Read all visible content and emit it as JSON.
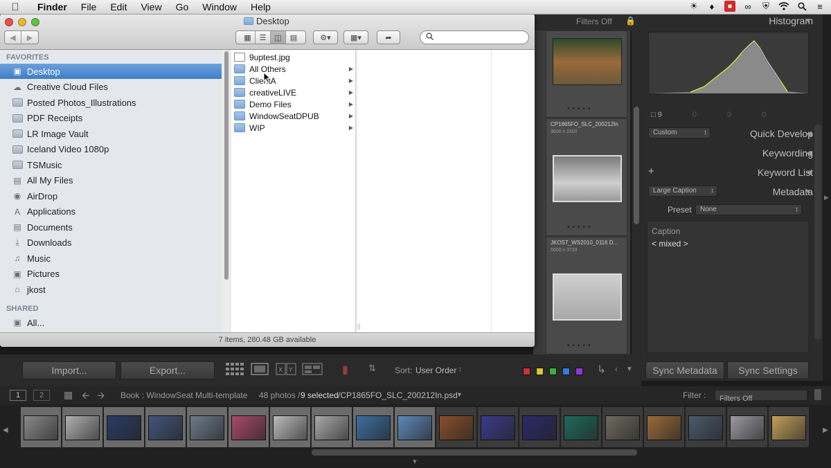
{
  "menubar": {
    "app": "Finder",
    "items": [
      "File",
      "Edit",
      "View",
      "Go",
      "Window",
      "Help"
    ]
  },
  "finder": {
    "title": "Desktop",
    "search_placeholder": "",
    "sidebar": {
      "favorites_header": "FAVORITES",
      "favorites": [
        {
          "label": "Desktop",
          "icon": "desktop-icon"
        },
        {
          "label": "Creative Cloud Files",
          "icon": "cloud-icon"
        },
        {
          "label": "Posted Photos_Illustrations",
          "icon": "folder-icon"
        },
        {
          "label": "PDF Receipts",
          "icon": "folder-icon"
        },
        {
          "label": "LR Image Vault",
          "icon": "folder-icon"
        },
        {
          "label": "Iceland Video 1080p",
          "icon": "folder-icon"
        },
        {
          "label": "TSMusic",
          "icon": "folder-icon"
        },
        {
          "label": "All My Files",
          "icon": "files-icon"
        },
        {
          "label": "AirDrop",
          "icon": "airdrop-icon"
        },
        {
          "label": "Applications",
          "icon": "applications-icon"
        },
        {
          "label": "Documents",
          "icon": "documents-icon"
        },
        {
          "label": "Downloads",
          "icon": "downloads-icon"
        },
        {
          "label": "Music",
          "icon": "music-icon"
        },
        {
          "label": "Pictures",
          "icon": "pictures-icon"
        },
        {
          "label": "jkost",
          "icon": "home-icon"
        }
      ],
      "shared_header": "SHARED",
      "shared": [
        {
          "label": "All...",
          "icon": "network-icon"
        }
      ]
    },
    "column1": [
      {
        "label": "9uptest.jpg",
        "type": "file"
      },
      {
        "label": "All Others",
        "type": "folder"
      },
      {
        "label": "ClientA",
        "type": "folder"
      },
      {
        "label": "creativeLIVE",
        "type": "folder"
      },
      {
        "label": "Demo Files",
        "type": "folder"
      },
      {
        "label": "WindowSeatDPUB",
        "type": "folder"
      },
      {
        "label": "WIP",
        "type": "folder"
      }
    ],
    "status": "7 items, 280.48 GB available"
  },
  "lightroom": {
    "filters_off_top": "Filters Off",
    "grid_cells": [
      {
        "caption": "CP1865FO_SLC_200212In",
        "dims": "3600 x 2400"
      },
      {
        "caption": "JKOST_WS2010_0116    D...",
        "dims": "5600 x 3733"
      }
    ],
    "right_panel": {
      "histogram": "Histogram",
      "histo_count": "9",
      "histo_zeros": [
        "0",
        "0",
        "0"
      ],
      "quick_develop_preset": "Custom",
      "quick_develop": "Quick Develop",
      "keywording": "Keywording",
      "keyword_list": "Keyword List",
      "keyword_plus": "+",
      "metadata_preset_select": "Large Caption",
      "metadata": "Metadata",
      "preset_label": "Preset",
      "preset_value": "None",
      "caption_label": "Caption",
      "caption_value": "< mixed >",
      "sync_metadata": "Sync Metadata",
      "sync_settings": "Sync Settings"
    },
    "toolbar": {
      "import": "Import...",
      "export": "Export...",
      "sort_label": "Sort:",
      "sort_value": "User Order",
      "swatches": [
        "#c8323a",
        "#d8c82e",
        "#3fae3a",
        "#3a7ad8",
        "#8a3ad8"
      ]
    },
    "filmstrip_header": {
      "page1": "1",
      "page2": "2",
      "source": "Book : WindowSeat Multi-template",
      "count": "48 photos /",
      "selected": "9 selected",
      "file": "/CP1865FO_SLC_200212In.psd",
      "filter_label": "Filter :",
      "filter_value": "Filters Off"
    },
    "filmstrip": [
      {
        "color": "#8a8a8a",
        "sel": true
      },
      {
        "color": "#b0b0b0",
        "sel": true
      },
      {
        "color": "#2a3c66",
        "sel": true
      },
      {
        "color": "#43557a",
        "sel": true
      },
      {
        "color": "#6d7a8c",
        "sel": true
      },
      {
        "color": "#a84a6a",
        "sel": true
      },
      {
        "color": "#bcbcbc",
        "sel": true
      },
      {
        "color": "#a9a9a9",
        "sel": true
      },
      {
        "color": "#3d6e9e",
        "sel": true
      },
      {
        "color": "#5e88b8",
        "sel": true
      },
      {
        "color": "#8a4e2a",
        "sel": false
      },
      {
        "color": "#3b3a8a",
        "sel": false
      },
      {
        "color": "#2a2a6a",
        "sel": false
      },
      {
        "color": "#1f6a5a",
        "sel": false
      },
      {
        "color": "#6e6a5e",
        "sel": false
      },
      {
        "color": "#9a6a3a",
        "sel": false
      },
      {
        "color": "#4a5a6a",
        "sel": false
      },
      {
        "color": "#9a9aa0",
        "sel": false
      },
      {
        "color": "#c2a05a",
        "sel": false
      }
    ]
  }
}
